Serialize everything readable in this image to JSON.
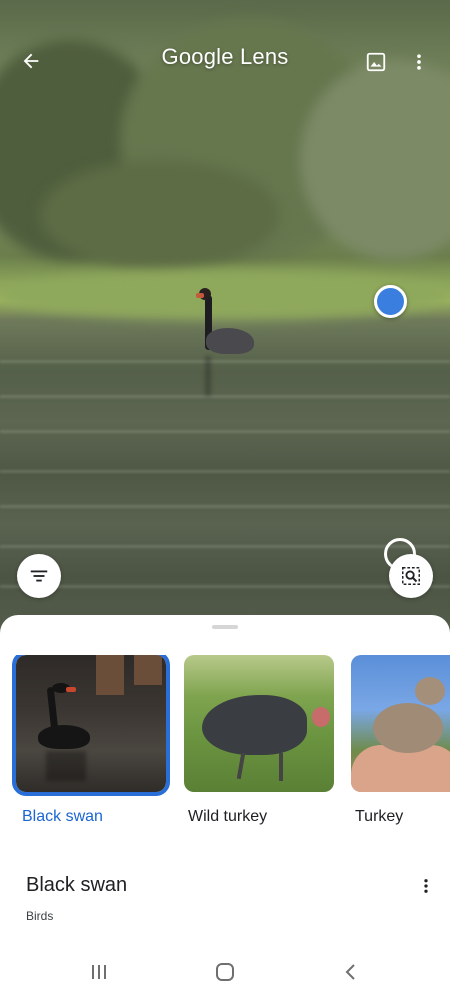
{
  "app": {
    "title": "Google Lens"
  },
  "topbar": {
    "back_icon": "arrow-left-icon",
    "gallery_icon": "image-icon",
    "more_icon": "more-vert-icon"
  },
  "scene_controls": {
    "filter_icon": "filter-list-icon",
    "search_region_icon": "image-search-icon"
  },
  "results": [
    {
      "label": "Black swan",
      "selected": true
    },
    {
      "label": "Wild turkey",
      "selected": false
    },
    {
      "label": "Turkey",
      "selected": false
    }
  ],
  "info": {
    "title": "Black swan",
    "subtitle": "Birds"
  },
  "colors": {
    "accent": "#1a66d2",
    "selection_border": "#2a6fd8",
    "point_marker": "#3a7fe0"
  }
}
